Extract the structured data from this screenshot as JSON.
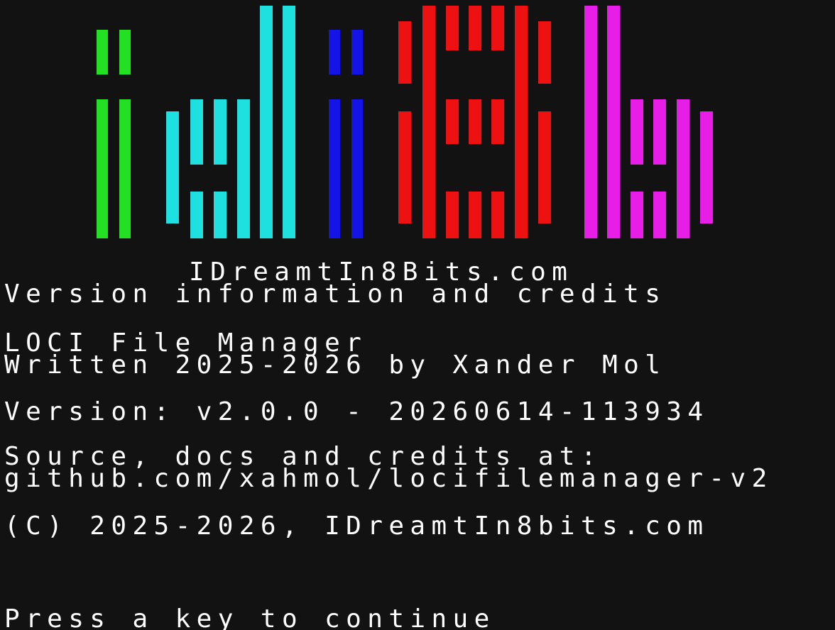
{
  "logo": {
    "colors": {
      "i": "#22e022",
      "d": "#1ee0e0",
      "i2": "#1414e6",
      "8": "#ee1111",
      "b": "#e81ee8"
    }
  },
  "lines": {
    "site": "IDreamtIn8Bits.com",
    "heading": "Version information and credits",
    "app_name": "LOCI File Manager",
    "written_by": "Written 2025-2026 by Xander Mol",
    "version": "Version: v2.0.0 - 20260614-113934",
    "source_label": "Source, docs and credits at:",
    "source_url": "github.com/xahmol/locifilemanager-v2",
    "copyright": "(C) 2025-2026, IDreamtIn8bits.com",
    "prompt": "Press a key to continue"
  }
}
